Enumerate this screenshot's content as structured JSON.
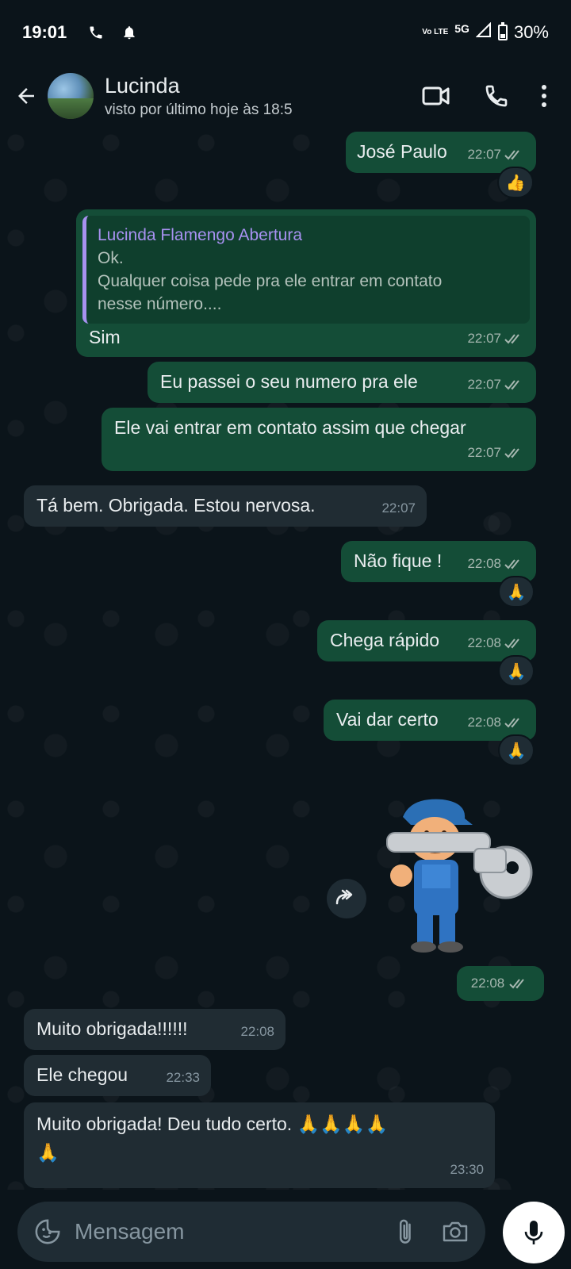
{
  "status_bar": {
    "time": "19:01",
    "network": "5G",
    "volte": "Vo LTE",
    "battery": "30%"
  },
  "header": {
    "contact_name": "Lucinda",
    "last_seen": "visto por último hoje às 18:5"
  },
  "messages": [
    {
      "dir": "out",
      "text": "José Paulo",
      "time": "22:07",
      "reaction": "👍"
    },
    {
      "dir": "out",
      "quote_author": "Lucinda Flamengo Abertura",
      "quote_line1": "Ok.",
      "quote_line2": "Qualquer coisa pede pra ele entrar em contato",
      "quote_line3": "nesse número....",
      "text": "Sim",
      "time": "22:07"
    },
    {
      "dir": "out",
      "text": "Eu passei o seu numero pra ele",
      "time": "22:07"
    },
    {
      "dir": "out",
      "text": "Ele vai entrar em contato assim que chegar",
      "time": "22:07"
    },
    {
      "dir": "in",
      "text": "Tá bem. Obrigada. Estou nervosa.",
      "time": "22:07"
    },
    {
      "dir": "out",
      "text": "Não fique !",
      "time": "22:08",
      "reaction": "🙏"
    },
    {
      "dir": "out",
      "text": "Chega rápido",
      "time": "22:08",
      "reaction": "🙏"
    },
    {
      "dir": "out",
      "text": "Vai dar certo",
      "time": "22:08",
      "reaction": "🙏"
    },
    {
      "dir": "out",
      "type": "sticker",
      "time": "22:08"
    },
    {
      "dir": "in",
      "text": "Muito obrigada!!!!!!",
      "time": "22:08"
    },
    {
      "dir": "in",
      "text": "Ele chegou",
      "time": "22:33"
    },
    {
      "dir": "in",
      "text_line1": "Muito obrigada! Deu tudo certo. 🙏🙏🙏🙏",
      "text_line2": "🙏",
      "time": "23:30"
    }
  ],
  "input": {
    "placeholder": "Mensagem"
  },
  "colors": {
    "background": "#0b141a",
    "outgoing_bubble": "#144d37",
    "incoming_bubble": "#202c33",
    "quote_accent": "#a791f0"
  }
}
